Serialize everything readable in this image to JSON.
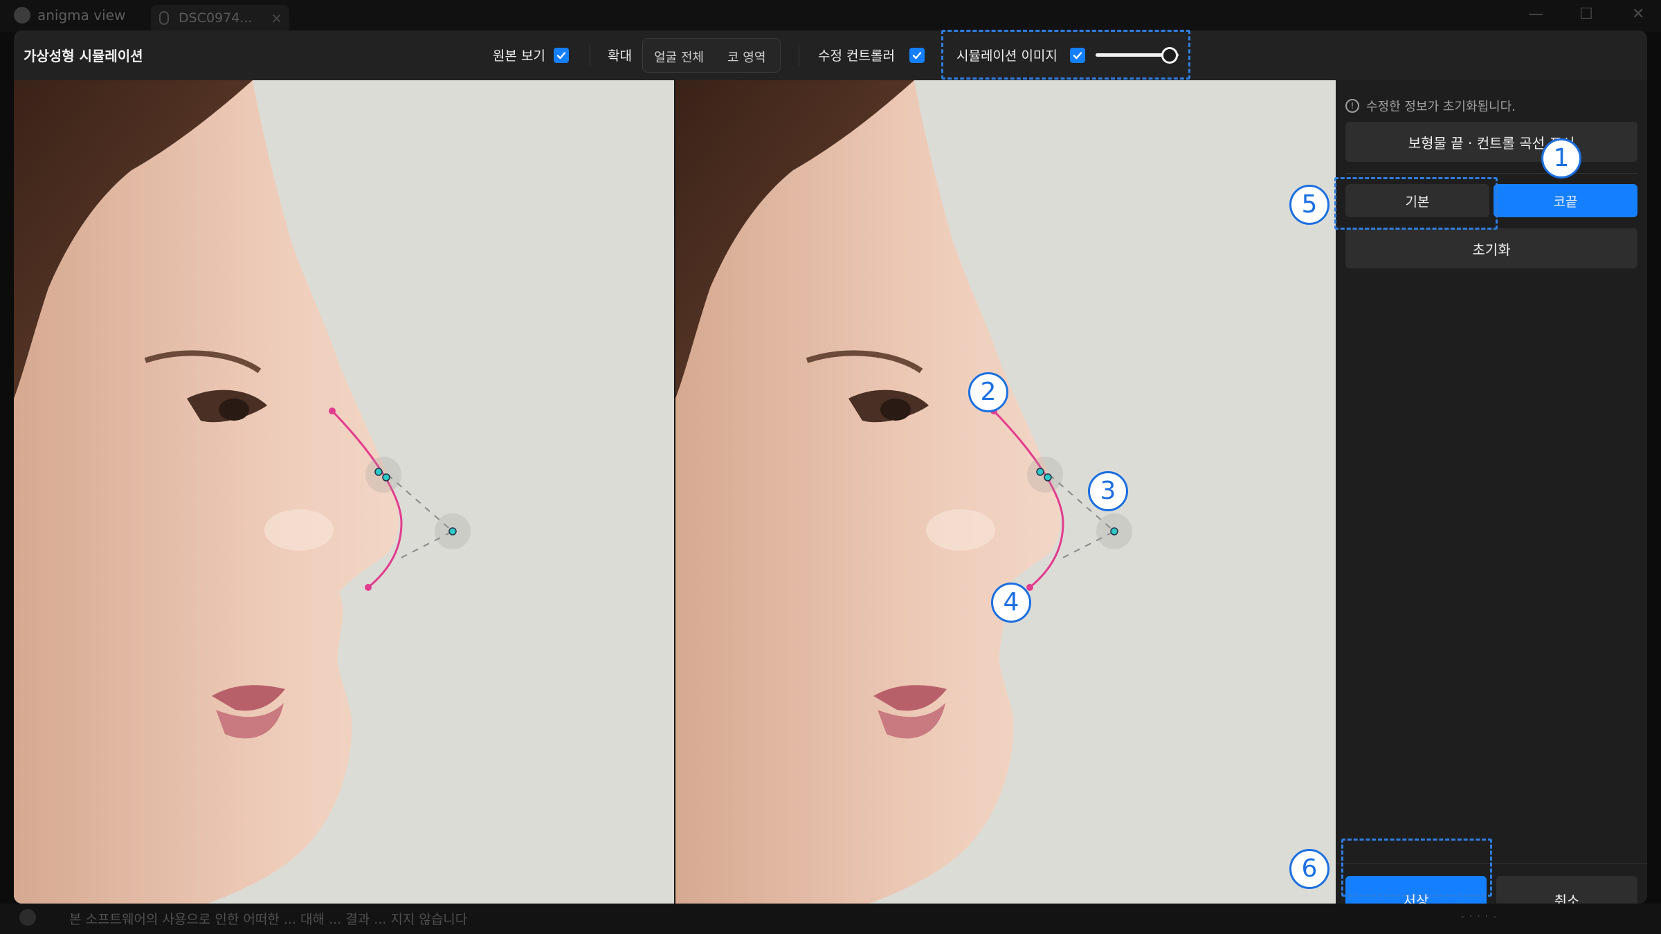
{
  "app": {
    "logo_text": "anigma view",
    "tab_label": "DSC0974...",
    "tab_close": "×",
    "window_controls": [
      "—",
      "☐",
      "✕"
    ],
    "footer_disclaimer": "본 소프트웨어의 사용으로 인한 어떠한 ... 대해 ... 결과 ... 지지 않습니다",
    "footer_right": "- · · · -"
  },
  "modal": {
    "title": "가상성형 시뮬레이션",
    "header": {
      "original_view_label": "원본 보기",
      "original_view_checked": true,
      "zoom_label": "확대",
      "zoom_options": [
        "얼굴 전체",
        "코 영역"
      ],
      "controller_label": "수정 컨트롤러",
      "controller_checked": true,
      "simulation_label": "시뮬레이션 이미지",
      "simulation_checked": true,
      "simulation_opacity": 1.0
    },
    "sidebar": {
      "notice": "수정한 정보가 초기화됩니다.",
      "notice_icon": "info-circle-icon",
      "curve_button": "보형물 끝 · 컨트롤 곡선 표시",
      "mode_tabs": [
        {
          "label": "기본",
          "active": false
        },
        {
          "label": "코끝",
          "active": true
        }
      ],
      "reset_button": "초기화",
      "save_button": "저장",
      "cancel_button": "취소"
    },
    "callouts": [
      "1",
      "2",
      "3",
      "4",
      "5",
      "6"
    ]
  },
  "colors": {
    "accent": "#1480ff",
    "annotation": "#2f7de1",
    "curve": "#e23c8e",
    "control_point": "#2ec8c8"
  }
}
